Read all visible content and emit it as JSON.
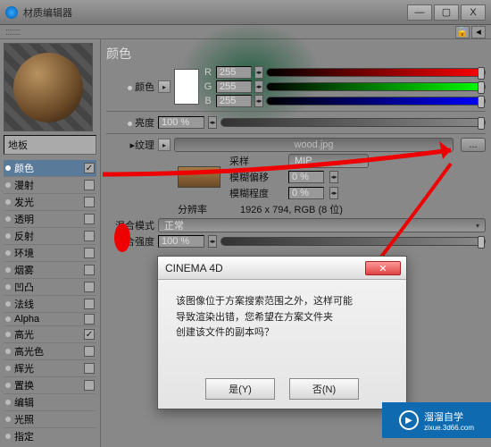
{
  "window": {
    "title": "材质编辑器",
    "min": "—",
    "max": "▢",
    "close": "X"
  },
  "material_name": "地板",
  "channels": [
    {
      "label": "颜色",
      "checked": true,
      "selected": true
    },
    {
      "label": "漫射",
      "checked": false
    },
    {
      "label": "发光",
      "checked": false
    },
    {
      "label": "透明",
      "checked": false
    },
    {
      "label": "反射",
      "checked": false
    },
    {
      "label": "环境",
      "checked": false
    },
    {
      "label": "烟雾",
      "checked": false
    },
    {
      "label": "凹凸",
      "checked": false
    },
    {
      "label": "法线",
      "checked": false
    },
    {
      "label": "Alpha",
      "checked": false
    },
    {
      "label": "高光",
      "checked": true
    },
    {
      "label": "高光色",
      "checked": false
    },
    {
      "label": "辉光",
      "checked": false
    },
    {
      "label": "置换",
      "checked": false
    },
    {
      "label": "编辑"
    },
    {
      "label": "光照"
    },
    {
      "label": "指定"
    }
  ],
  "panel": {
    "section_title": "颜色",
    "color_label": "颜色",
    "r_label": "R",
    "r_value": "255",
    "g_label": "G",
    "g_value": "255",
    "b_label": "B",
    "b_value": "255",
    "brightness_label": "亮度",
    "brightness_value": "100 %",
    "texture_label": "纹理",
    "texture_file": "wood.jpg",
    "sample_label": "采样",
    "sample_value": "MIP",
    "blur_offset_label": "模糊偏移",
    "blur_offset_value": "0 %",
    "blur_scale_label": "模糊程度",
    "blur_scale_value": "0 %",
    "resolution_label": "分辨率",
    "resolution_value": "1926 x 794, RGB (8 位)",
    "blend_mode_label": "混合模式",
    "blend_mode_value": "正常",
    "blend_strength_label": "混合强度",
    "blend_strength_value": "100 %",
    "dots": "..."
  },
  "dialog": {
    "title": "CINEMA 4D",
    "body_l1": "该图像位于方案搜索范围之外，这样可能",
    "body_l2": "导致渲染出错，您希望在方案文件夹",
    "body_l3": "创建该文件的副本吗？",
    "yes": "是(Y)",
    "no": "否(N)"
  },
  "watermark": {
    "brand": "溜溜自学",
    "url": "zixue.3d66.com"
  }
}
